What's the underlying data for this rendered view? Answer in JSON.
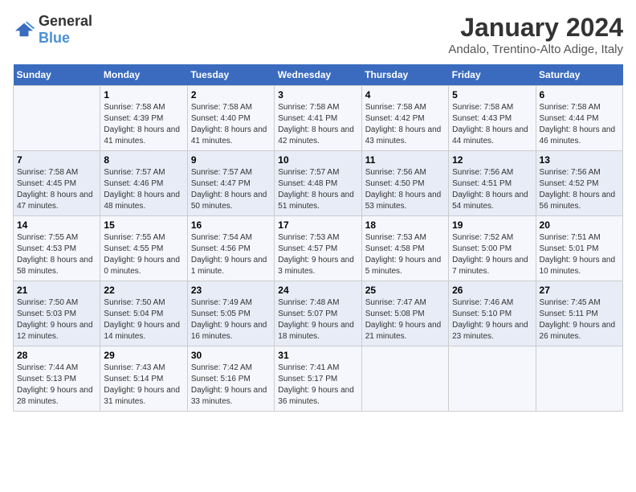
{
  "logo": {
    "text_general": "General",
    "text_blue": "Blue"
  },
  "header": {
    "month_year": "January 2024",
    "location": "Andalo, Trentino-Alto Adige, Italy"
  },
  "days_of_week": [
    "Sunday",
    "Monday",
    "Tuesday",
    "Wednesday",
    "Thursday",
    "Friday",
    "Saturday"
  ],
  "weeks": [
    [
      {
        "day": "",
        "sunrise": "",
        "sunset": "",
        "daylight": ""
      },
      {
        "day": "1",
        "sunrise": "Sunrise: 7:58 AM",
        "sunset": "Sunset: 4:39 PM",
        "daylight": "Daylight: 8 hours and 41 minutes."
      },
      {
        "day": "2",
        "sunrise": "Sunrise: 7:58 AM",
        "sunset": "Sunset: 4:40 PM",
        "daylight": "Daylight: 8 hours and 41 minutes."
      },
      {
        "day": "3",
        "sunrise": "Sunrise: 7:58 AM",
        "sunset": "Sunset: 4:41 PM",
        "daylight": "Daylight: 8 hours and 42 minutes."
      },
      {
        "day": "4",
        "sunrise": "Sunrise: 7:58 AM",
        "sunset": "Sunset: 4:42 PM",
        "daylight": "Daylight: 8 hours and 43 minutes."
      },
      {
        "day": "5",
        "sunrise": "Sunrise: 7:58 AM",
        "sunset": "Sunset: 4:43 PM",
        "daylight": "Daylight: 8 hours and 44 minutes."
      },
      {
        "day": "6",
        "sunrise": "Sunrise: 7:58 AM",
        "sunset": "Sunset: 4:44 PM",
        "daylight": "Daylight: 8 hours and 46 minutes."
      }
    ],
    [
      {
        "day": "7",
        "sunrise": "Sunrise: 7:58 AM",
        "sunset": "Sunset: 4:45 PM",
        "daylight": "Daylight: 8 hours and 47 minutes."
      },
      {
        "day": "8",
        "sunrise": "Sunrise: 7:57 AM",
        "sunset": "Sunset: 4:46 PM",
        "daylight": "Daylight: 8 hours and 48 minutes."
      },
      {
        "day": "9",
        "sunrise": "Sunrise: 7:57 AM",
        "sunset": "Sunset: 4:47 PM",
        "daylight": "Daylight: 8 hours and 50 minutes."
      },
      {
        "day": "10",
        "sunrise": "Sunrise: 7:57 AM",
        "sunset": "Sunset: 4:48 PM",
        "daylight": "Daylight: 8 hours and 51 minutes."
      },
      {
        "day": "11",
        "sunrise": "Sunrise: 7:56 AM",
        "sunset": "Sunset: 4:50 PM",
        "daylight": "Daylight: 8 hours and 53 minutes."
      },
      {
        "day": "12",
        "sunrise": "Sunrise: 7:56 AM",
        "sunset": "Sunset: 4:51 PM",
        "daylight": "Daylight: 8 hours and 54 minutes."
      },
      {
        "day": "13",
        "sunrise": "Sunrise: 7:56 AM",
        "sunset": "Sunset: 4:52 PM",
        "daylight": "Daylight: 8 hours and 56 minutes."
      }
    ],
    [
      {
        "day": "14",
        "sunrise": "Sunrise: 7:55 AM",
        "sunset": "Sunset: 4:53 PM",
        "daylight": "Daylight: 8 hours and 58 minutes."
      },
      {
        "day": "15",
        "sunrise": "Sunrise: 7:55 AM",
        "sunset": "Sunset: 4:55 PM",
        "daylight": "Daylight: 9 hours and 0 minutes."
      },
      {
        "day": "16",
        "sunrise": "Sunrise: 7:54 AM",
        "sunset": "Sunset: 4:56 PM",
        "daylight": "Daylight: 9 hours and 1 minute."
      },
      {
        "day": "17",
        "sunrise": "Sunrise: 7:53 AM",
        "sunset": "Sunset: 4:57 PM",
        "daylight": "Daylight: 9 hours and 3 minutes."
      },
      {
        "day": "18",
        "sunrise": "Sunrise: 7:53 AM",
        "sunset": "Sunset: 4:58 PM",
        "daylight": "Daylight: 9 hours and 5 minutes."
      },
      {
        "day": "19",
        "sunrise": "Sunrise: 7:52 AM",
        "sunset": "Sunset: 5:00 PM",
        "daylight": "Daylight: 9 hours and 7 minutes."
      },
      {
        "day": "20",
        "sunrise": "Sunrise: 7:51 AM",
        "sunset": "Sunset: 5:01 PM",
        "daylight": "Daylight: 9 hours and 10 minutes."
      }
    ],
    [
      {
        "day": "21",
        "sunrise": "Sunrise: 7:50 AM",
        "sunset": "Sunset: 5:03 PM",
        "daylight": "Daylight: 9 hours and 12 minutes."
      },
      {
        "day": "22",
        "sunrise": "Sunrise: 7:50 AM",
        "sunset": "Sunset: 5:04 PM",
        "daylight": "Daylight: 9 hours and 14 minutes."
      },
      {
        "day": "23",
        "sunrise": "Sunrise: 7:49 AM",
        "sunset": "Sunset: 5:05 PM",
        "daylight": "Daylight: 9 hours and 16 minutes."
      },
      {
        "day": "24",
        "sunrise": "Sunrise: 7:48 AM",
        "sunset": "Sunset: 5:07 PM",
        "daylight": "Daylight: 9 hours and 18 minutes."
      },
      {
        "day": "25",
        "sunrise": "Sunrise: 7:47 AM",
        "sunset": "Sunset: 5:08 PM",
        "daylight": "Daylight: 9 hours and 21 minutes."
      },
      {
        "day": "26",
        "sunrise": "Sunrise: 7:46 AM",
        "sunset": "Sunset: 5:10 PM",
        "daylight": "Daylight: 9 hours and 23 minutes."
      },
      {
        "day": "27",
        "sunrise": "Sunrise: 7:45 AM",
        "sunset": "Sunset: 5:11 PM",
        "daylight": "Daylight: 9 hours and 26 minutes."
      }
    ],
    [
      {
        "day": "28",
        "sunrise": "Sunrise: 7:44 AM",
        "sunset": "Sunset: 5:13 PM",
        "daylight": "Daylight: 9 hours and 28 minutes."
      },
      {
        "day": "29",
        "sunrise": "Sunrise: 7:43 AM",
        "sunset": "Sunset: 5:14 PM",
        "daylight": "Daylight: 9 hours and 31 minutes."
      },
      {
        "day": "30",
        "sunrise": "Sunrise: 7:42 AM",
        "sunset": "Sunset: 5:16 PM",
        "daylight": "Daylight: 9 hours and 33 minutes."
      },
      {
        "day": "31",
        "sunrise": "Sunrise: 7:41 AM",
        "sunset": "Sunset: 5:17 PM",
        "daylight": "Daylight: 9 hours and 36 minutes."
      },
      {
        "day": "",
        "sunrise": "",
        "sunset": "",
        "daylight": ""
      },
      {
        "day": "",
        "sunrise": "",
        "sunset": "",
        "daylight": ""
      },
      {
        "day": "",
        "sunrise": "",
        "sunset": "",
        "daylight": ""
      }
    ]
  ]
}
